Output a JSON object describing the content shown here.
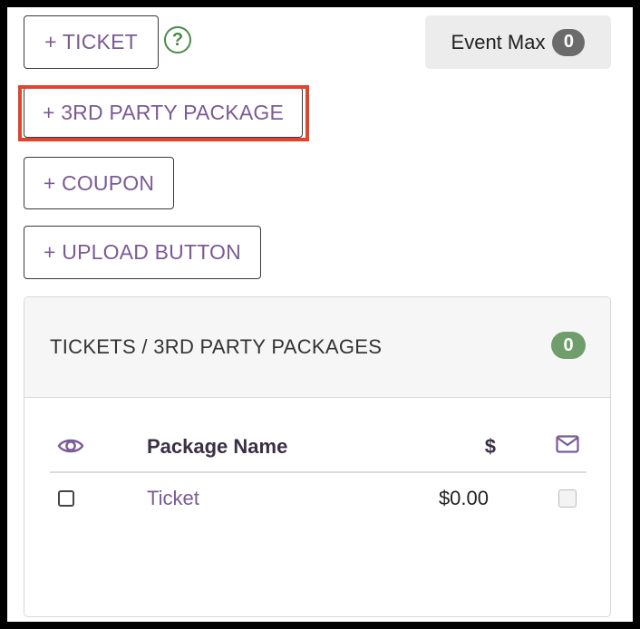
{
  "buttons": {
    "ticket": "+ TICKET",
    "third_party_package": "+ 3RD PARTY PACKAGE",
    "coupon": "+ COUPON",
    "upload_button": "+ UPLOAD BUTTON"
  },
  "help_label": "?",
  "event_max": {
    "label": "Event Max",
    "count": "0"
  },
  "panel": {
    "title": "TICKETS / 3RD PARTY PACKAGES",
    "count": "0",
    "columns": {
      "visibility_icon": "eye-icon",
      "name": "Package Name",
      "price": "$",
      "email_icon": "envelope-icon"
    },
    "rows": [
      {
        "name": "Ticket",
        "price": "$0.00",
        "visible": false,
        "email": false
      }
    ]
  },
  "colors": {
    "link_purple": "#7b5a96",
    "highlight_red": "#e0442a",
    "badge_green": "#6f9e6c",
    "badge_gray": "#6b6b6b"
  }
}
